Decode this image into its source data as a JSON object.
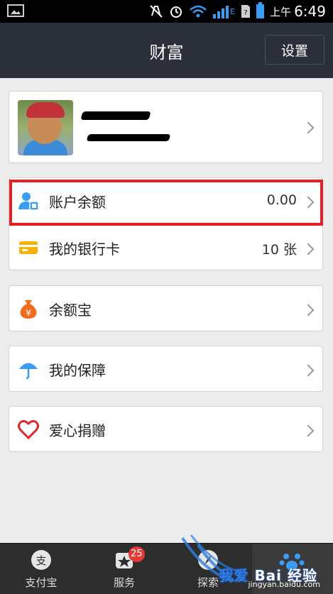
{
  "statusbar": {
    "time_prefix": "上午",
    "time": "6:49",
    "network": "E"
  },
  "header": {
    "title": "财富",
    "settings_label": "设置"
  },
  "rows": {
    "balance": {
      "label": "账户余额",
      "value": "0.00"
    },
    "bankcard": {
      "label": "我的银行卡",
      "value": "10 张"
    },
    "yuebao": {
      "label": "余额宝"
    },
    "protection": {
      "label": "我的保障"
    },
    "charity": {
      "label": "爱心捐赠"
    }
  },
  "tabs": [
    {
      "label": "支付宝",
      "icon": "alipay-icon"
    },
    {
      "label": "服务",
      "icon": "star-icon",
      "badge": "25"
    },
    {
      "label": "探索",
      "icon": "compass-icon"
    }
  ],
  "watermark": {
    "text": "Bai 经验",
    "url": "jingyan.baidu.com",
    "text_cn": "我爱"
  },
  "colors": {
    "titlebar": "#2b2f3a",
    "highlight": "#e81e24",
    "accent_blue": "#3a9cf2",
    "tabbar": "#2d2d2d"
  }
}
